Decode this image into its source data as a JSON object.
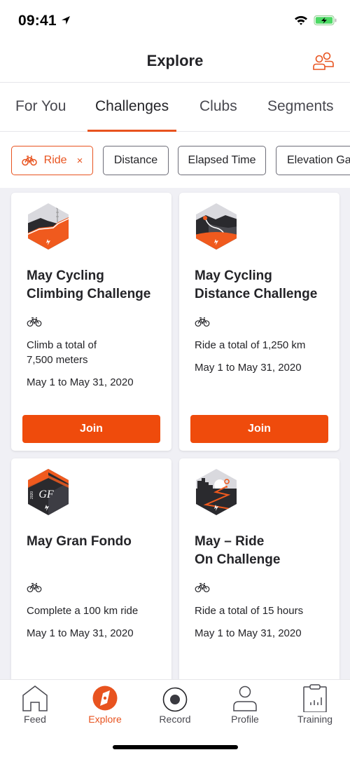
{
  "status_bar": {
    "time": "09:41",
    "icons": [
      "location-arrow-icon",
      "wifi-icon",
      "battery-charging-icon"
    ],
    "battery_color": "#4cd964"
  },
  "header": {
    "title": "Explore",
    "right_icon": "people-icon"
  },
  "tabs": [
    {
      "label": "For You",
      "active": false
    },
    {
      "label": "Challenges",
      "active": true
    },
    {
      "label": "Clubs",
      "active": false
    },
    {
      "label": "Segments",
      "active": false
    }
  ],
  "filters": [
    {
      "label": "Ride",
      "icon": "bike-icon",
      "active": true,
      "removable": true,
      "remove_glyph": "×"
    },
    {
      "label": "Distance",
      "active": false
    },
    {
      "label": "Elapsed Time",
      "active": false
    },
    {
      "label": "Elevation Gain",
      "active": false
    }
  ],
  "challenges": [
    {
      "title": "May Cycling Climbing Challenge",
      "title_lines": [
        "May Cycling",
        "Climbing Challenge"
      ],
      "sport_icon": "bike-icon",
      "description": "Climb a total of 7,500 meters",
      "desc_lines": [
        "Climb a total of",
        "7,500 meters"
      ],
      "dates": "May 1 to May 31, 2020",
      "button": "Join",
      "badge": "climbing-challenge-badge"
    },
    {
      "title": "May Cycling Distance Challenge",
      "title_lines": [
        "May Cycling",
        "Distance Challenge"
      ],
      "sport_icon": "bike-icon",
      "description": "Ride a total of 1,250 km",
      "dates": "May 1 to May 31, 2020",
      "button": "Join",
      "badge": "distance-challenge-badge"
    },
    {
      "title": "May Gran Fondo",
      "sport_icon": "bike-icon",
      "description": "Complete a 100 km ride",
      "dates": "May 1 to May 31, 2020",
      "badge": "gran-fondo-badge",
      "badge_text": "GF",
      "badge_year": "2020"
    },
    {
      "title": "May – Ride On Challenge",
      "title_lines": [
        "May – Ride",
        "On Challenge"
      ],
      "sport_icon": "bike-icon",
      "description": "Ride a total of 15 hours",
      "dates": "May 1 to May 31, 2020",
      "badge": "ride-on-badge"
    }
  ],
  "bottom_nav": [
    {
      "label": "Feed",
      "icon": "home-icon",
      "active": false
    },
    {
      "label": "Explore",
      "icon": "compass-icon",
      "active": true
    },
    {
      "label": "Record",
      "icon": "record-icon",
      "active": false
    },
    {
      "label": "Profile",
      "icon": "person-icon",
      "active": false
    },
    {
      "label": "Training",
      "icon": "clipboard-chart-icon",
      "active": false
    }
  ],
  "colors": {
    "accent": "#e8531f",
    "join_button": "#ef4b0c",
    "text": "#242428",
    "background": "#f0f0f5"
  }
}
